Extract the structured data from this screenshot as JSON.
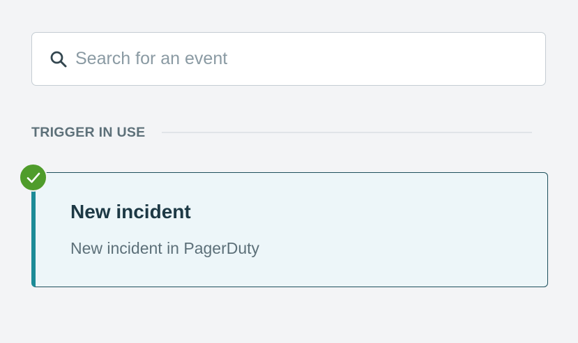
{
  "search": {
    "placeholder": "Search for an event",
    "value": "",
    "icon": "search-icon"
  },
  "section": {
    "title": "TRIGGER IN USE"
  },
  "trigger": {
    "title": "New incident",
    "subtitle": "New incident in PagerDuty",
    "status_icon": "checkmark-icon",
    "selected": true
  },
  "colors": {
    "background": "#f3f4f6",
    "card_background": "#edf6f9",
    "card_accent": "#1c8b97",
    "card_border": "#1d4f5c",
    "success": "#4f9c2b",
    "muted_text": "#5d7079",
    "title_text": "#1d3945"
  }
}
